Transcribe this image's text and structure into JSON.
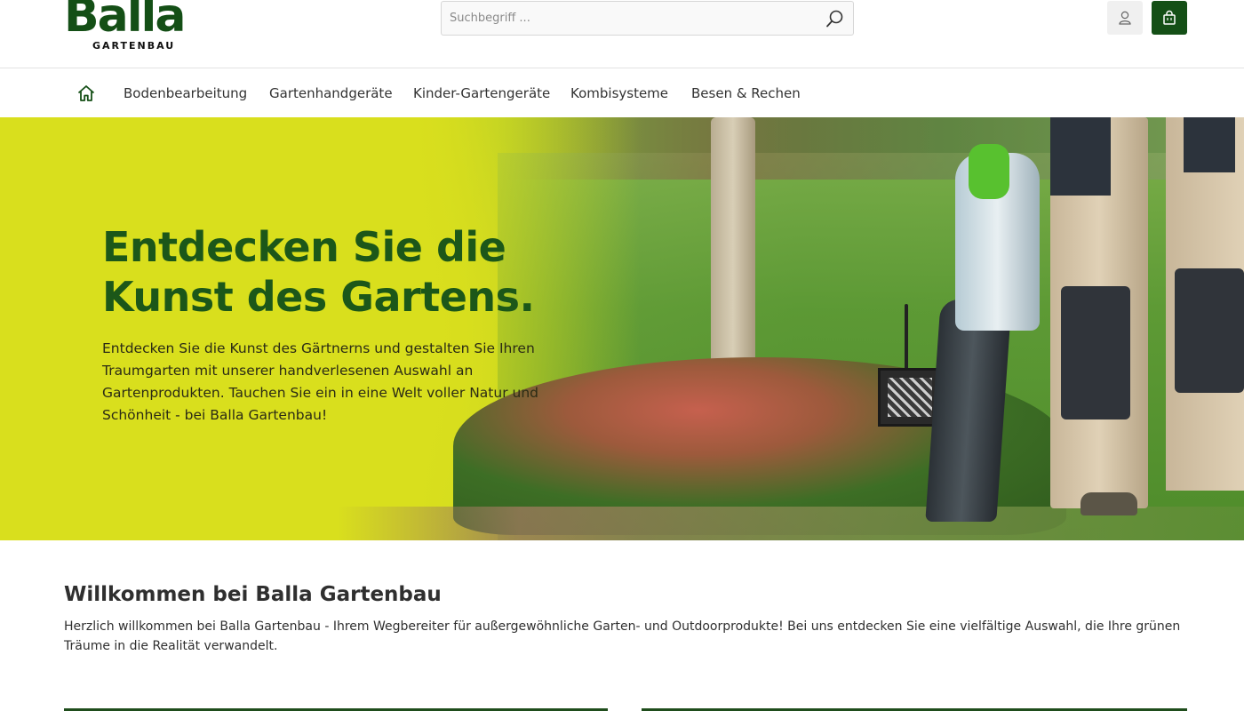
{
  "header": {
    "logo": {
      "word": "Balla",
      "sub": "GARTENBAU"
    },
    "search": {
      "placeholder": "Suchbegriff ..."
    },
    "colors": {
      "brand": "#144f16",
      "account_bg": "#f0f0f0"
    }
  },
  "nav": {
    "home_icon": "home-icon",
    "items": [
      {
        "label": "Bodenbearbeitung"
      },
      {
        "label": "Gartenhandgeräte"
      },
      {
        "label": "Kinder-Gartengeräte"
      },
      {
        "label": "Kombisysteme"
      },
      {
        "label": "Besen & Rechen"
      }
    ]
  },
  "hero": {
    "title_line1": "Entdecken Sie die",
    "title_line2": "Kunst des Gartens.",
    "text": "Entdecken Sie die Kunst des Gärtnerns und gestalten Sie Ihren Traumgarten mit unserer handverlesenen Auswahl an Gartenprodukten. Tauchen Sie ein in eine Welt voller Natur und Schönheit - bei Balla Gartenbau!"
  },
  "intro": {
    "title": "Willkommen bei Balla Gartenbau",
    "text": "Herzlich willkommen bei Balla Gartenbau - Ihrem Wegbereiter für außergewöhnliche Garten- und Outdoorprodukte! Bei uns entdecken Sie eine vielfältige Auswahl, die Ihre grünen Träume in die Realität verwandelt."
  }
}
